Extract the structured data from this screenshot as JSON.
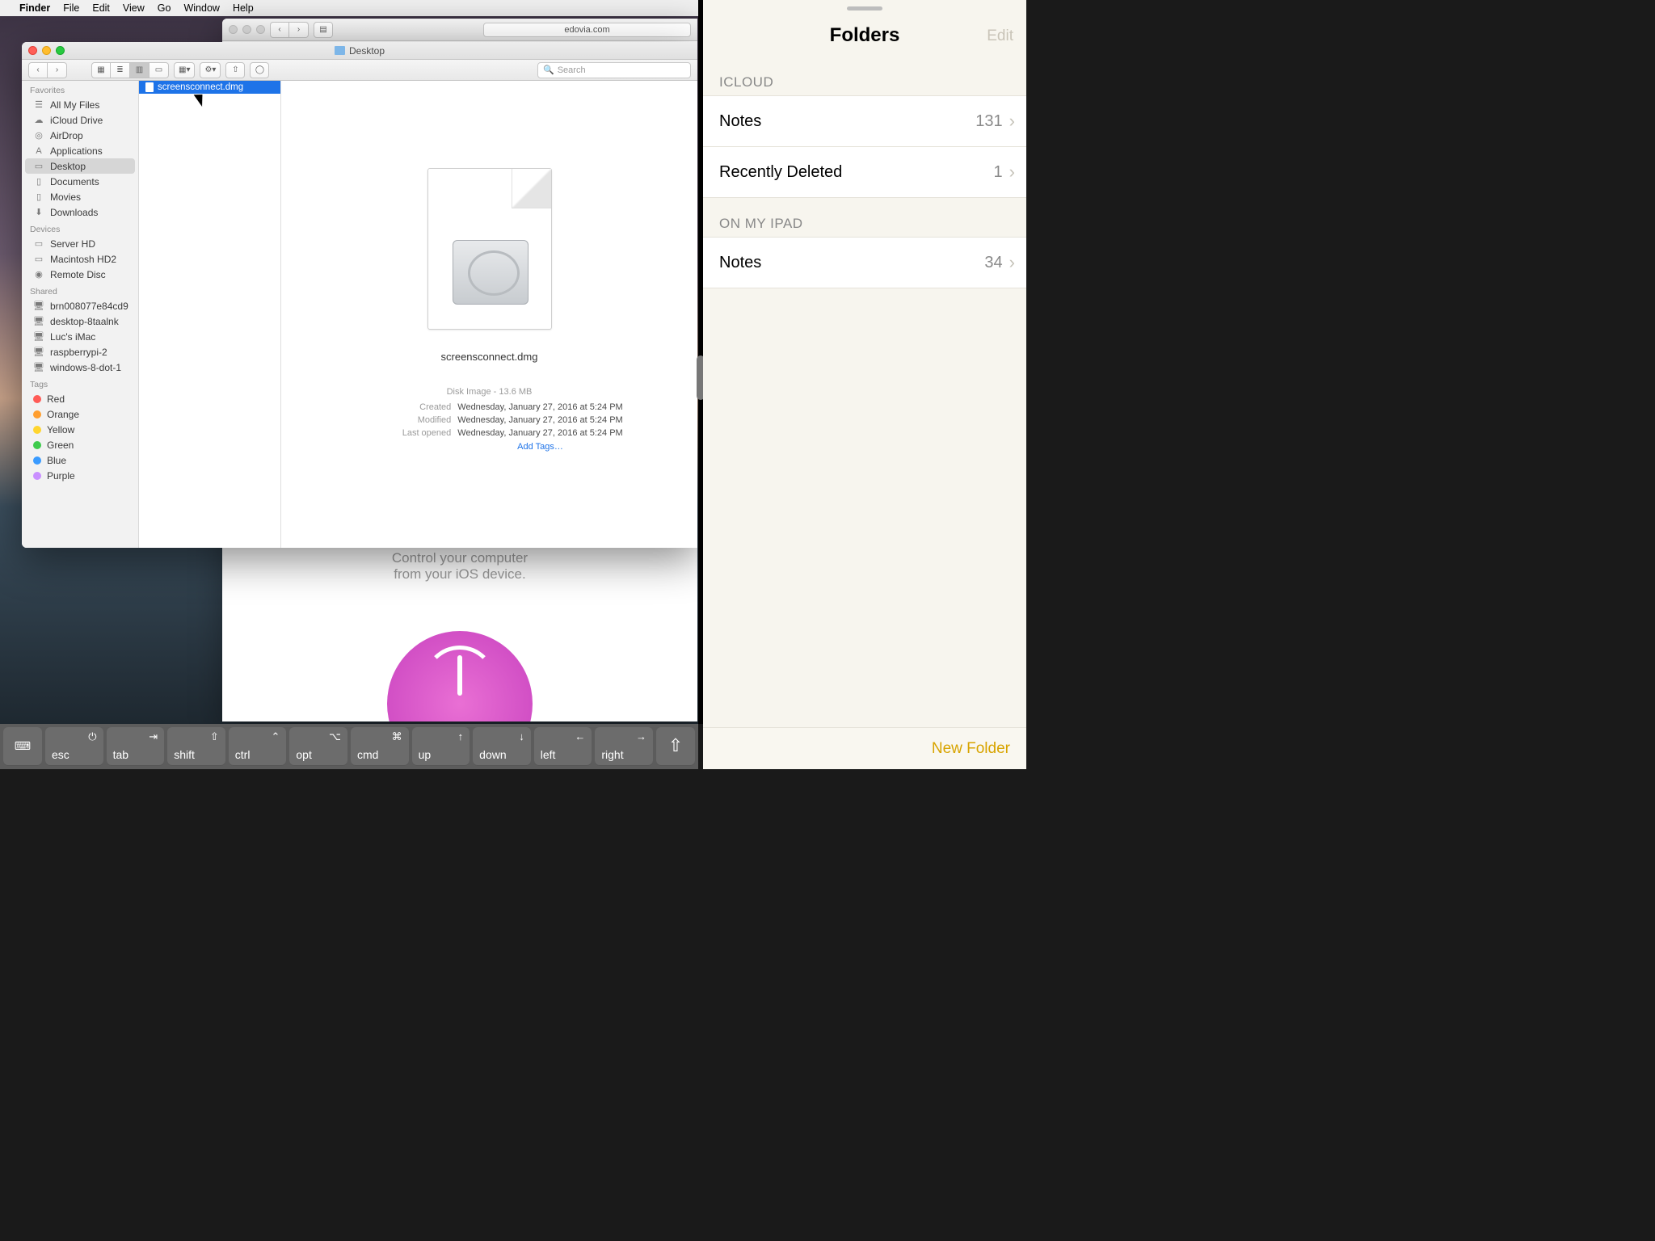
{
  "menubar": {
    "app": "Finder",
    "items": [
      "File",
      "Edit",
      "View",
      "Go",
      "Window",
      "Help"
    ]
  },
  "safari": {
    "address": "edovia.com",
    "tagline1": "Control your computer",
    "tagline2": "from your iOS device."
  },
  "finder": {
    "title": "Desktop",
    "search_placeholder": "Search",
    "sidebar": {
      "favorites_h": "Favorites",
      "favorites": [
        "All My Files",
        "iCloud Drive",
        "AirDrop",
        "Applications",
        "Desktop",
        "Documents",
        "Movies",
        "Downloads"
      ],
      "devices_h": "Devices",
      "devices": [
        "Server HD",
        "Macintosh HD2",
        "Remote Disc"
      ],
      "shared_h": "Shared",
      "shared": [
        "brn008077e84cd9",
        "desktop-8taalnk",
        "Luc's iMac",
        "raspberrypi-2",
        "windows-8-dot-1"
      ],
      "tags_h": "Tags",
      "tags": [
        {
          "label": "Red",
          "c": "#ff5b56"
        },
        {
          "label": "Orange",
          "c": "#ff9e2e"
        },
        {
          "label": "Yellow",
          "c": "#ffd52e"
        },
        {
          "label": "Green",
          "c": "#3ecb4c"
        },
        {
          "label": "Blue",
          "c": "#3a9bff"
        },
        {
          "label": "Purple",
          "c": "#c98fff"
        }
      ]
    },
    "file": {
      "name": "screensconnect.dmg"
    },
    "preview": {
      "name": "screensconnect.dmg",
      "type": "Disk Image - 13.6 MB",
      "rows": [
        {
          "k": "Created",
          "v": "Wednesday, January 27, 2016 at 5:24 PM"
        },
        {
          "k": "Modified",
          "v": "Wednesday, January 27, 2016 at 5:24 PM"
        },
        {
          "k": "Last opened",
          "v": "Wednesday, January 27, 2016 at 5:24 PM"
        }
      ],
      "add_tags": "Add Tags…"
    }
  },
  "notes": {
    "title": "Folders",
    "edit": "Edit",
    "s1": "ICLOUD",
    "s1rows": [
      {
        "label": "Notes",
        "count": "131"
      },
      {
        "label": "Recently Deleted",
        "count": "1"
      }
    ],
    "s2": "ON MY IPAD",
    "s2rows": [
      {
        "label": "Notes",
        "count": "34"
      }
    ],
    "new_folder": "New Folder"
  },
  "keys": [
    {
      "label": "esc",
      "sym": "⏻"
    },
    {
      "label": "tab",
      "sym": "⇥"
    },
    {
      "label": "shift",
      "sym": "⇧"
    },
    {
      "label": "ctrl",
      "sym": "⌃"
    },
    {
      "label": "opt",
      "sym": "⌥"
    },
    {
      "label": "cmd",
      "sym": "⌘"
    },
    {
      "label": "up",
      "sym": "↑"
    },
    {
      "label": "down",
      "sym": "↓"
    },
    {
      "label": "left",
      "sym": "←"
    },
    {
      "label": "right",
      "sym": "→"
    }
  ],
  "share_glyph": "⇧"
}
